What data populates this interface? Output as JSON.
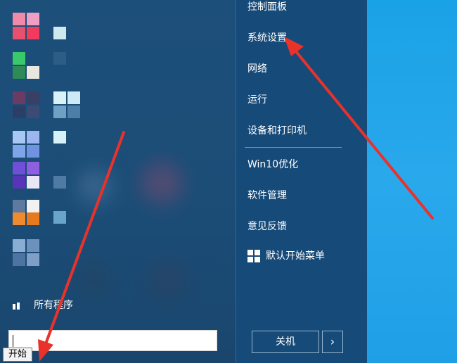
{
  "right_panel": {
    "items": [
      {
        "label": "控制面板"
      },
      {
        "label": "系统设置"
      },
      {
        "label": "网络"
      },
      {
        "label": "运行"
      },
      {
        "label": "设备和打印机"
      },
      {
        "label": "Win10优化"
      },
      {
        "label": "软件管理"
      },
      {
        "label": "意见反馈"
      },
      {
        "label": "默认开始菜单",
        "icon": "windows-logo-icon"
      }
    ],
    "shutdown_label": "关机",
    "shutdown_arrow": "›"
  },
  "left_panel": {
    "all_programs_label": "所有程序",
    "search": {
      "value": "",
      "placeholder": ""
    }
  },
  "tooltip": {
    "label": "开始"
  },
  "annotations": {
    "arrow_color": "#e8322a"
  },
  "colors": {
    "menu_bg": "#1d4f7b",
    "right_bg": "#164a78",
    "desktop": "#1aa2e6"
  }
}
